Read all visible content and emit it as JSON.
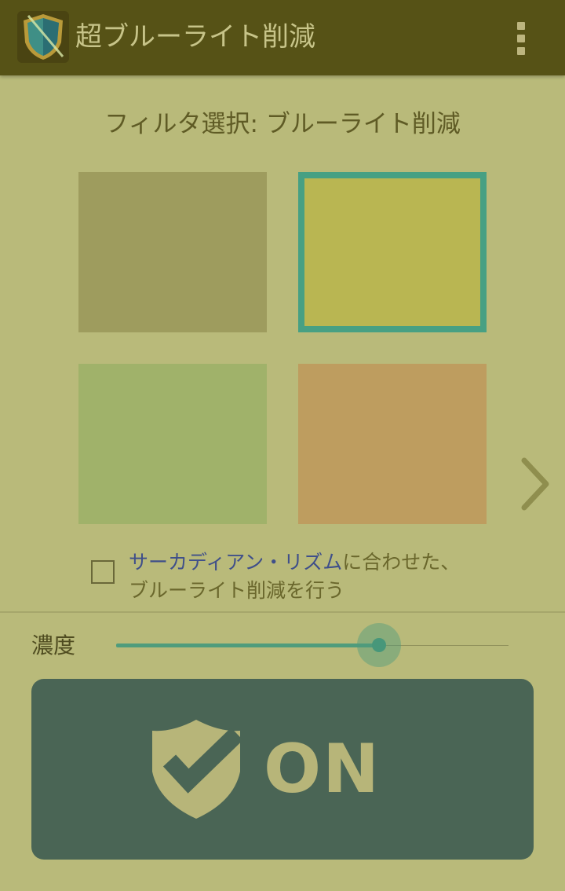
{
  "app": {
    "title": "超ブルーライト削減",
    "icon": "shield-icon",
    "menu_icon": "more-vert-icon"
  },
  "filter": {
    "heading": "フィルタ選択: ブルーライト削減",
    "swatches": [
      {
        "color": "#9e9c5e",
        "selected": false
      },
      {
        "color": "#b9b652",
        "selected": true
      },
      {
        "color": "#a0b26a",
        "selected": false
      },
      {
        "color": "#be9d5f",
        "selected": false
      }
    ],
    "selected_border_color": "#47a083",
    "next_icon": "chevron-right-icon"
  },
  "circadian": {
    "checked": false,
    "link_text": "サーカディアン・リズム",
    "rest_text": "に合わせた、",
    "line2": "ブルーライト削減を行う"
  },
  "intensity": {
    "label": "濃度",
    "value_fraction": 0.67
  },
  "power": {
    "label": "ON",
    "icon": "shield-check-icon"
  },
  "colors": {
    "appbar": "#565216",
    "background": "#b9ba7a",
    "accent": "#47a083",
    "button": "#4a6555"
  }
}
